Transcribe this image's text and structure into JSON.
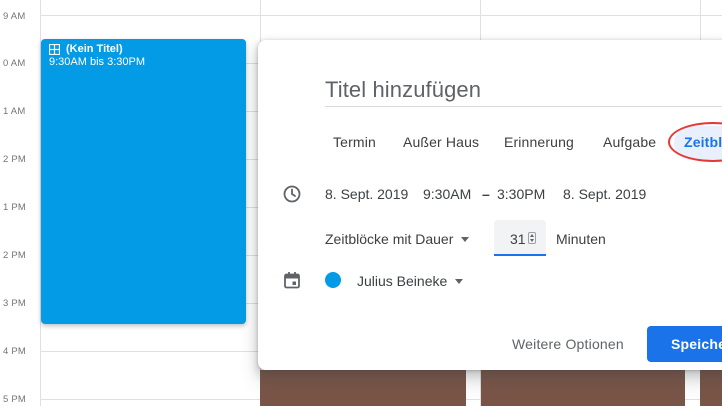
{
  "time_labels": [
    "9 AM",
    "0 AM",
    "1 AM",
    "2 PM",
    "1 PM",
    "2 PM",
    "3 PM",
    "4 PM",
    "5 PM"
  ],
  "event": {
    "title": "(Kein Titel)",
    "time": "9:30AM bis 3:30PM",
    "color": "#039be5",
    "icon": "grid-icon"
  },
  "dialog": {
    "title_placeholder": "Titel hinzufügen",
    "tabs": [
      "Termin",
      "Außer Haus",
      "Erinnerung",
      "Aufgabe"
    ],
    "active_tab": "Zeitbl",
    "start_date": "8. Sept. 2019",
    "start_time": "9:30AM",
    "separator": "–",
    "end_time": "3:30PM",
    "end_date": "8. Sept. 2019",
    "block_type": "Zeitblöcke mit Dauer",
    "duration_value": "31",
    "duration_unit": "Minuten",
    "calendar_name": "Julius Beineke",
    "calendar_color": "#039be5",
    "more_options": "Weitere Optionen",
    "save_label": "Speiche"
  },
  "colors": {
    "accent": "#1a73e8",
    "highlight_ring": "#e53935",
    "event_brown": "#795548"
  }
}
